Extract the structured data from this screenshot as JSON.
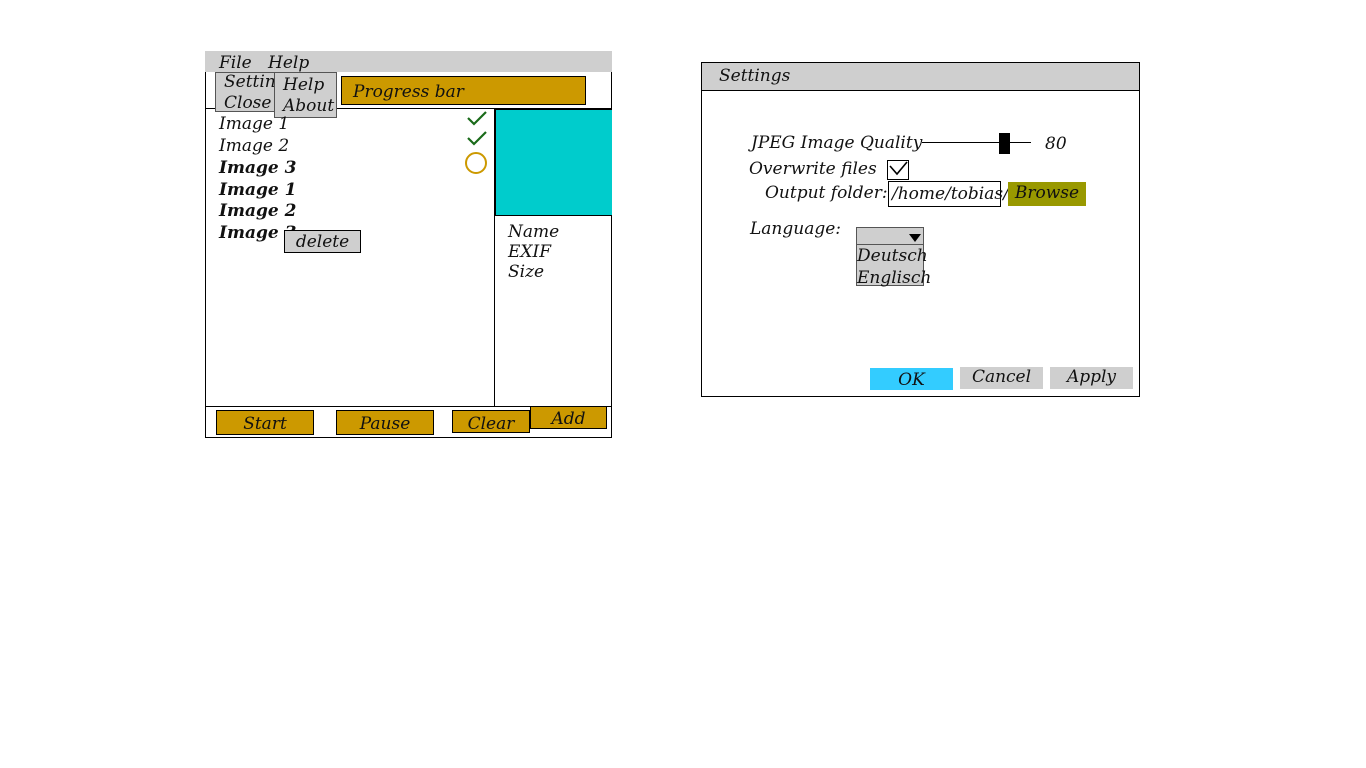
{
  "main": {
    "menu": {
      "file": "File",
      "help": "Help"
    },
    "file_menu": {
      "items": [
        "Setting",
        "Close"
      ]
    },
    "help_menu": {
      "items": [
        "Help",
        "About"
      ]
    },
    "progress_label": "Progress bar",
    "images": [
      {
        "label": "Image 1",
        "status": "done"
      },
      {
        "label": "Image 2",
        "status": "done"
      },
      {
        "label": "Image 3",
        "status": "pending"
      },
      {
        "label": "Image 1"
      },
      {
        "label": "Image 2"
      },
      {
        "label": "Image 3"
      }
    ],
    "delete_label": "delete",
    "details": [
      "Name",
      "EXIF",
      "Size"
    ],
    "buttons": {
      "start": "Start",
      "pause": "Pause",
      "clear": "Clear",
      "add": "Add"
    }
  },
  "settings": {
    "title": "Settings",
    "jpeg_quality_label": "JPEG Image Quality",
    "jpeg_quality_value": "80",
    "overwrite_label": "Overwrite files",
    "overwrite_checked": true,
    "output_folder_label": "Output folder:",
    "output_folder_value": "/home/tobias/",
    "browse_label": "Browse",
    "language_label": "Language:",
    "language_options": [
      "Deutsch",
      "Englisch"
    ],
    "ok_label": "OK",
    "cancel_label": "Cancel",
    "apply_label": "Apply"
  },
  "colors": {
    "gold": "#cc9900",
    "teal_preview": "#00cccc",
    "olive_button": "#999900",
    "ok_blue": "#33ccff",
    "menu_gray": "#cfcfcf",
    "check_green": "#1a6b1a"
  }
}
